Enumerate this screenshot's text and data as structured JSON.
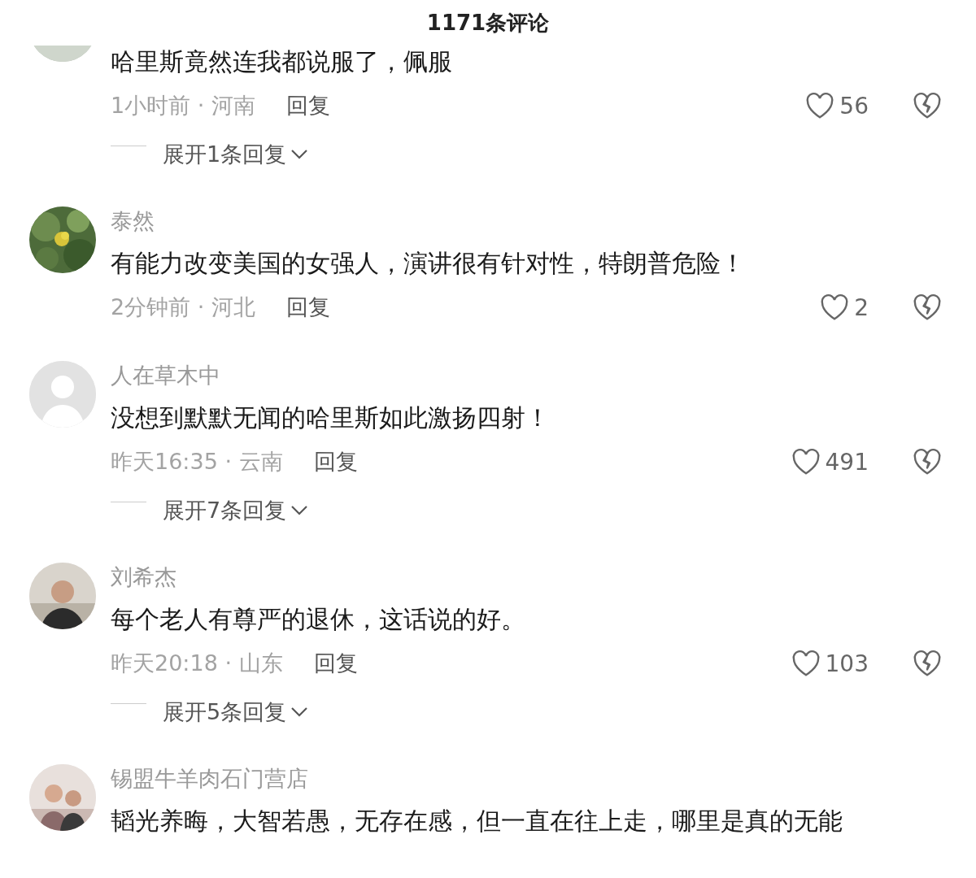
{
  "header": {
    "title": "1171条评论"
  },
  "comments": [
    {
      "text": "哈里斯竟然连我都说服了，佩服",
      "time_place": "1小时前 · 河南",
      "reply": "回复",
      "likes": "56",
      "expand": "展开1条回复"
    },
    {
      "name": "泰然",
      "text": "有能力改变美国的女强人，演讲很有针对性，特朗普危险！",
      "time_place": "2分钟前 · 河北",
      "reply": "回复",
      "likes": "2"
    },
    {
      "avatar": {
        "kind": "default"
      },
      "name": "人在草木中",
      "text": "没想到默默无闻的哈里斯如此激扬四射！",
      "time_place": "昨天16:35 · 云南",
      "reply": "回复",
      "likes": "491",
      "expand": "展开7条回复"
    },
    {
      "name": "刘希杰",
      "text": "每个老人有尊严的退休，这话说的好。",
      "time_place": "昨天20:18 · 山东",
      "reply": "回复",
      "likes": "103",
      "expand": "展开5条回复"
    },
    {
      "name": "锡盟牛羊肉石门营店",
      "text": "韬光养晦，大智若愚，无存在感，但一直在往上走，哪里是真的无能"
    }
  ]
}
